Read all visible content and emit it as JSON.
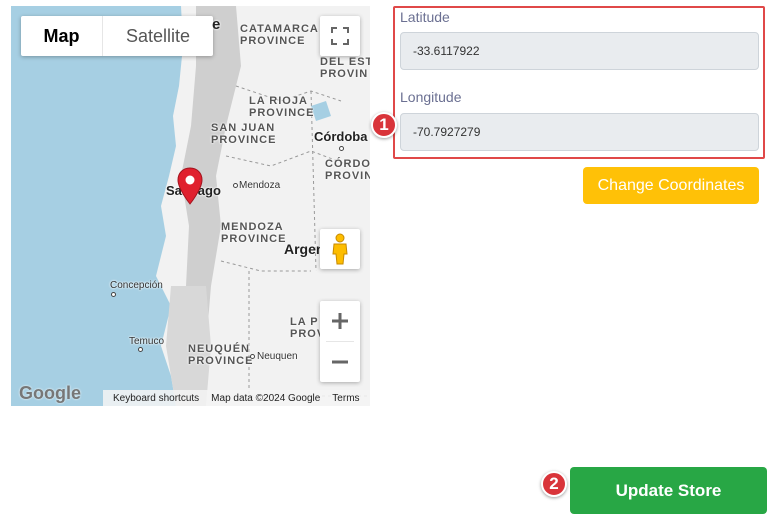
{
  "map": {
    "type_map": "Map",
    "type_satellite": "Satellite",
    "logo": "Google",
    "attribution": {
      "shortcuts": "Keyboard shortcuts",
      "data": "Map data ©2024 Google",
      "terms": "Terms"
    },
    "labels": {
      "catamarca_1": "CATAMARCA",
      "catamarca_2": "PROVINCE",
      "estero_1": "DEL EST",
      "estero_2": "PROVIN",
      "rioja_1": "LA RIOJA",
      "rioja_2": "PROVINCE",
      "sanjuan_1": "SAN JUAN",
      "sanjuan_2": "PROVINCE",
      "cordobaprov_1": "CÓRDOB",
      "cordobaprov_2": "PROVIN",
      "mendozaprov_1": "MENDOZA",
      "mendozaprov_2": "PROVINCE",
      "pampa_1": "LA P",
      "pampa_2": "PROV",
      "neuquen_1": "NEUQUÉN",
      "neuquen_2": "PROVINCE",
      "top_e": "e"
    },
    "cities": {
      "santiago": "Santiago",
      "mendoza": "Mendoza",
      "cordoba": "Córdoba",
      "argentina": "Argen",
      "concepcion": "Concepción",
      "temuco": "Temuco",
      "neuquen": "Neuquen"
    }
  },
  "form": {
    "latitude_label": "Latitude",
    "latitude_value": "-33.6117922",
    "longitude_label": "Longitude",
    "longitude_value": "-70.7927279",
    "change_button": "Change Coordinates",
    "update_button": "Update Store"
  },
  "annotations": {
    "badge_1": "1",
    "badge_2": "2"
  },
  "colors": {
    "highlight_border": "#e04848",
    "change_button": "#ffc107",
    "update_button": "#28a745",
    "pin": "#e0202e"
  }
}
